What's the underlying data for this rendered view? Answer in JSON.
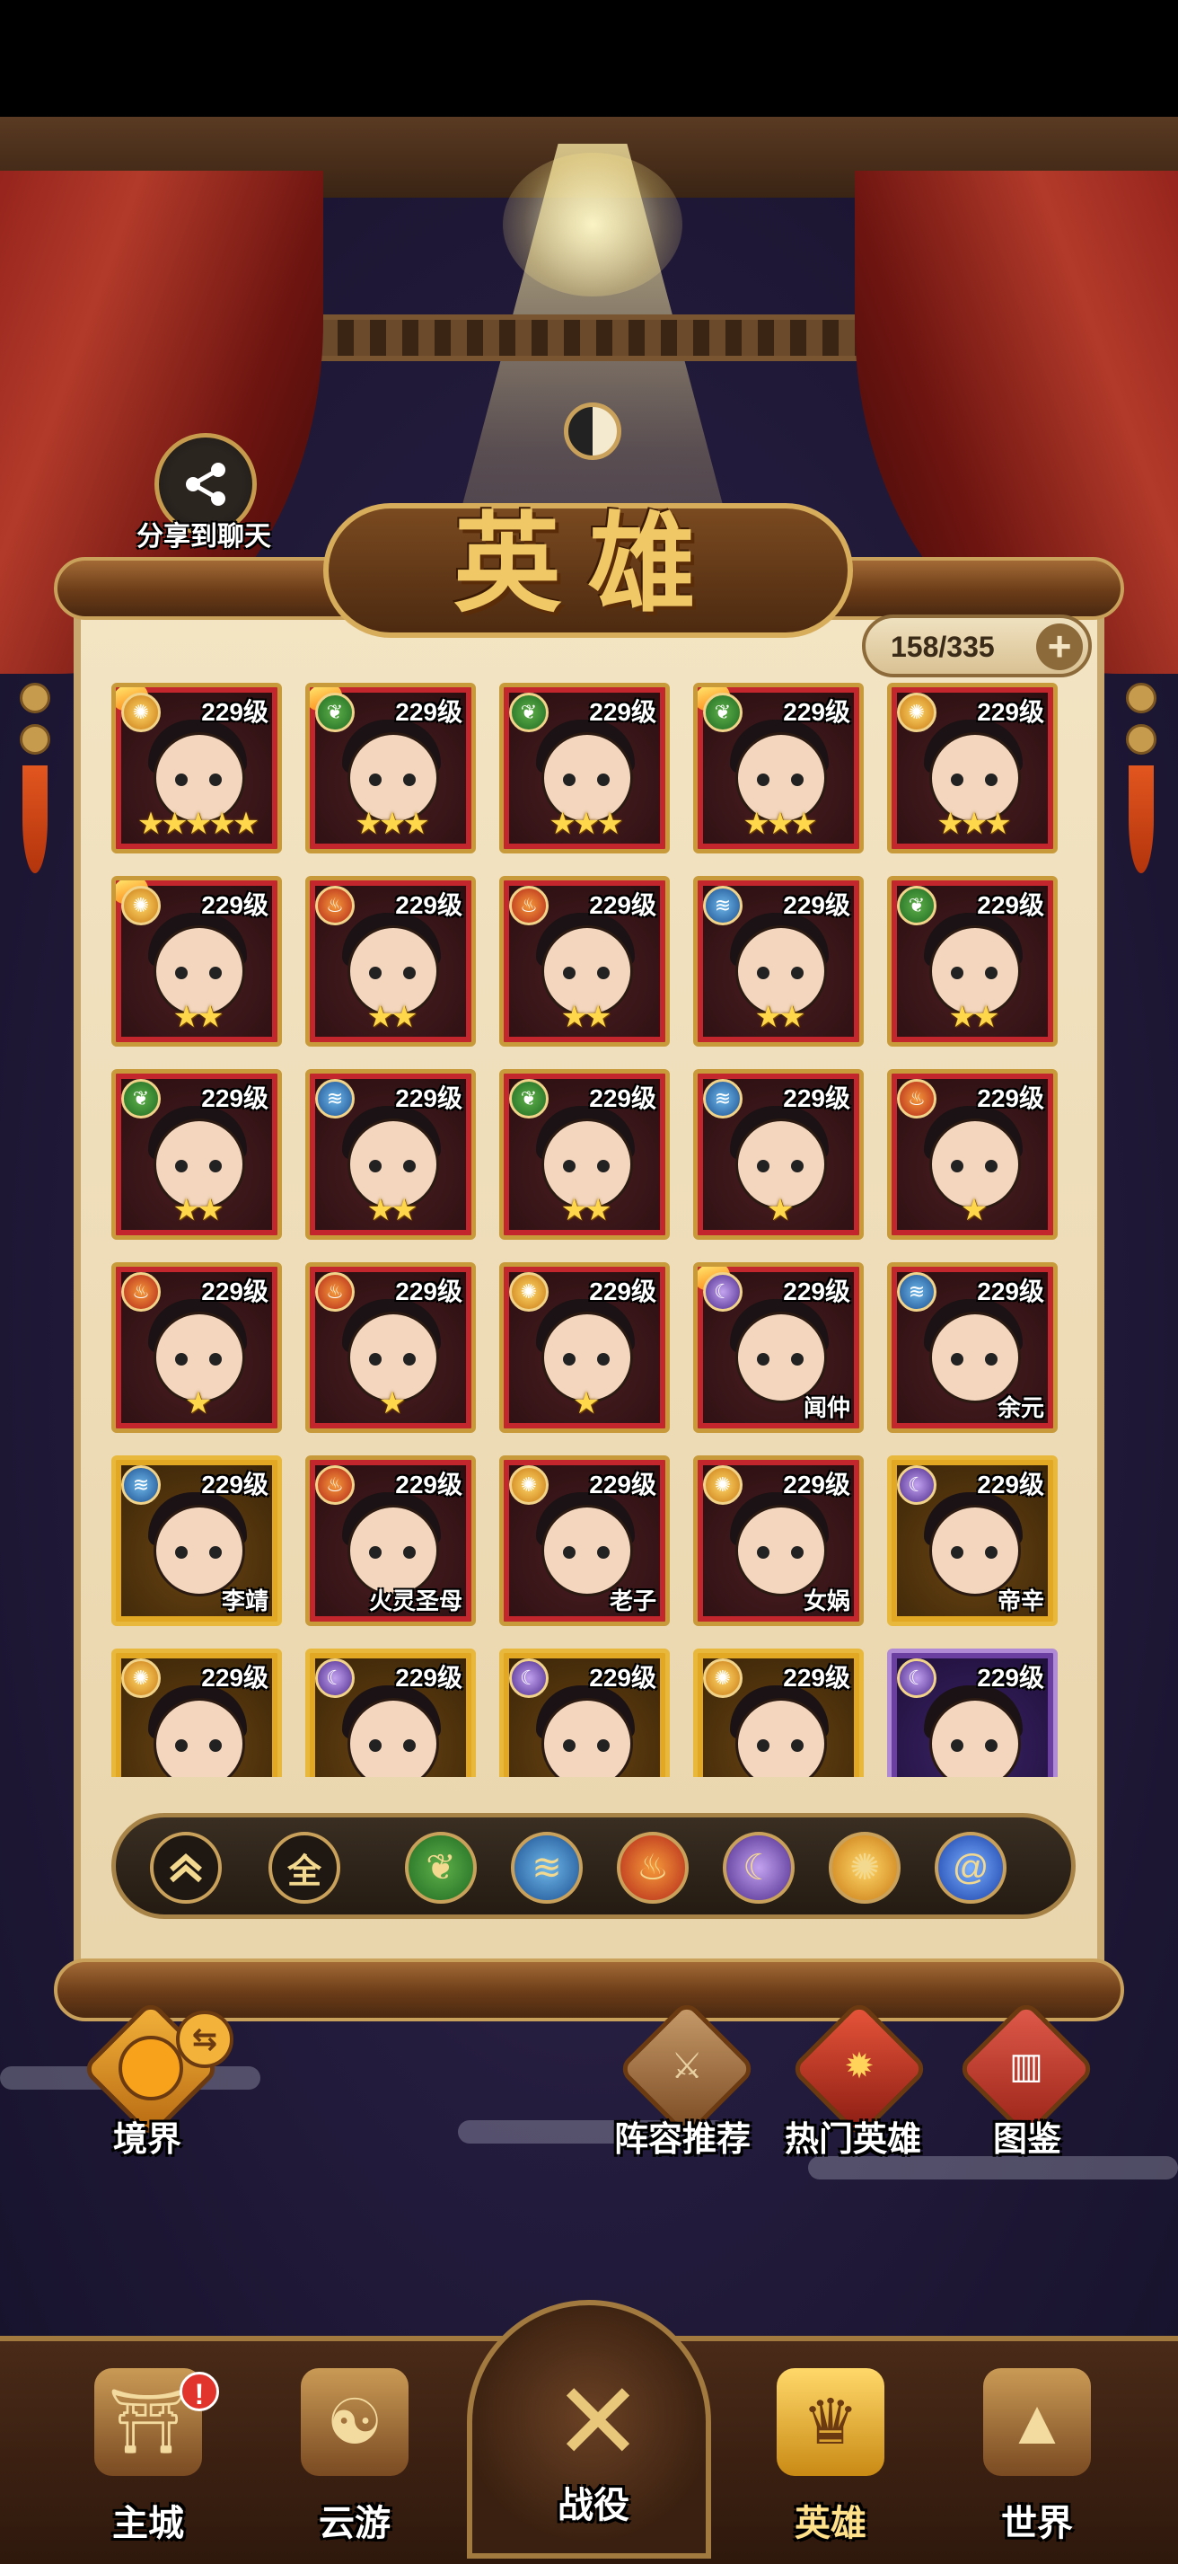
{
  "share": {
    "label": "分享到聊天",
    "icon": "share-icon"
  },
  "title": "英雄",
  "counter": {
    "text": "158/335",
    "plus": "+"
  },
  "colors": {
    "accent": "#c9a15a",
    "card_red": "#c3272d",
    "card_gold": "#e2a824",
    "card_purple": "#6b3fa1"
  },
  "heroes": [
    {
      "level": "229级",
      "element": "sun",
      "stars": "★★★★★",
      "name": "",
      "frame": "red",
      "flame": true
    },
    {
      "level": "229级",
      "element": "wood",
      "stars": "★★★",
      "name": "",
      "frame": "red",
      "flame": true
    },
    {
      "level": "229级",
      "element": "wood",
      "stars": "★★★",
      "name": "",
      "frame": "red",
      "flame": false
    },
    {
      "level": "229级",
      "element": "wood",
      "stars": "★★★",
      "name": "",
      "frame": "red",
      "flame": true
    },
    {
      "level": "229级",
      "element": "sun",
      "stars": "★★★",
      "name": "",
      "frame": "red",
      "flame": false
    },
    {
      "level": "229级",
      "element": "sun",
      "stars": "★★",
      "name": "",
      "frame": "red",
      "flame": true
    },
    {
      "level": "229级",
      "element": "fire",
      "stars": "★★",
      "name": "",
      "frame": "red",
      "flame": false
    },
    {
      "level": "229级",
      "element": "fire",
      "stars": "★★",
      "name": "",
      "frame": "red",
      "flame": false
    },
    {
      "level": "229级",
      "element": "water",
      "stars": "★★",
      "name": "",
      "frame": "red",
      "flame": false
    },
    {
      "level": "229级",
      "element": "wood",
      "stars": "★★",
      "name": "",
      "frame": "red",
      "flame": false
    },
    {
      "level": "229级",
      "element": "wood",
      "stars": "★★",
      "name": "",
      "frame": "red",
      "flame": false
    },
    {
      "level": "229级",
      "element": "water",
      "stars": "★★",
      "name": "",
      "frame": "red",
      "flame": false
    },
    {
      "level": "229级",
      "element": "wood",
      "stars": "★★",
      "name": "",
      "frame": "red",
      "flame": false
    },
    {
      "level": "229级",
      "element": "water",
      "stars": "★",
      "name": "",
      "frame": "red",
      "flame": false
    },
    {
      "level": "229级",
      "element": "fire",
      "stars": "★",
      "name": "",
      "frame": "red",
      "flame": false
    },
    {
      "level": "229级",
      "element": "fire",
      "stars": "★",
      "name": "",
      "frame": "red",
      "flame": false
    },
    {
      "level": "229级",
      "element": "fire",
      "stars": "★",
      "name": "",
      "frame": "red",
      "flame": false
    },
    {
      "level": "229级",
      "element": "sun",
      "stars": "★",
      "name": "",
      "frame": "red",
      "flame": false
    },
    {
      "level": "229级",
      "element": "moon",
      "stars": "",
      "name": "闻仲",
      "frame": "red",
      "flame": true
    },
    {
      "level": "229级",
      "element": "water",
      "stars": "",
      "name": "余元",
      "frame": "red",
      "flame": false
    },
    {
      "level": "229级",
      "element": "water",
      "stars": "",
      "name": "李靖",
      "frame": "gold",
      "flame": false
    },
    {
      "level": "229级",
      "element": "fire",
      "stars": "",
      "name": "火灵圣母",
      "frame": "red",
      "flame": false
    },
    {
      "level": "229级",
      "element": "sun",
      "stars": "",
      "name": "老子",
      "frame": "red",
      "flame": false
    },
    {
      "level": "229级",
      "element": "sun",
      "stars": "",
      "name": "女娲",
      "frame": "red",
      "flame": false
    },
    {
      "level": "229级",
      "element": "moon",
      "stars": "",
      "name": "帝辛",
      "frame": "gold",
      "flame": false
    },
    {
      "level": "229级",
      "element": "sun",
      "stars": "",
      "name": "",
      "frame": "gold",
      "flame": false
    },
    {
      "level": "229级",
      "element": "moon",
      "stars": "",
      "name": "",
      "frame": "gold",
      "flame": false
    },
    {
      "level": "229级",
      "element": "moon",
      "stars": "",
      "name": "",
      "frame": "gold",
      "flame": false
    },
    {
      "level": "229级",
      "element": "sun",
      "stars": "",
      "name": "",
      "frame": "gold",
      "flame": false
    },
    {
      "level": "229级",
      "element": "moon",
      "stars": "",
      "name": "",
      "frame": "purple",
      "flame": false
    }
  ],
  "filters": {
    "collapse_icon": "chevron-double-up-icon",
    "all_label": "全",
    "elements": [
      "wood",
      "water",
      "fire",
      "moon",
      "sun",
      "storm"
    ]
  },
  "side_buttons": {
    "realm": "境界",
    "lineup": "阵容推荐",
    "hot": "热门英雄",
    "atlas": "图鉴"
  },
  "nav": {
    "city": "主城",
    "travel": "云游",
    "battle": "战役",
    "hero": "英雄",
    "world": "世界",
    "city_badge": "!"
  }
}
